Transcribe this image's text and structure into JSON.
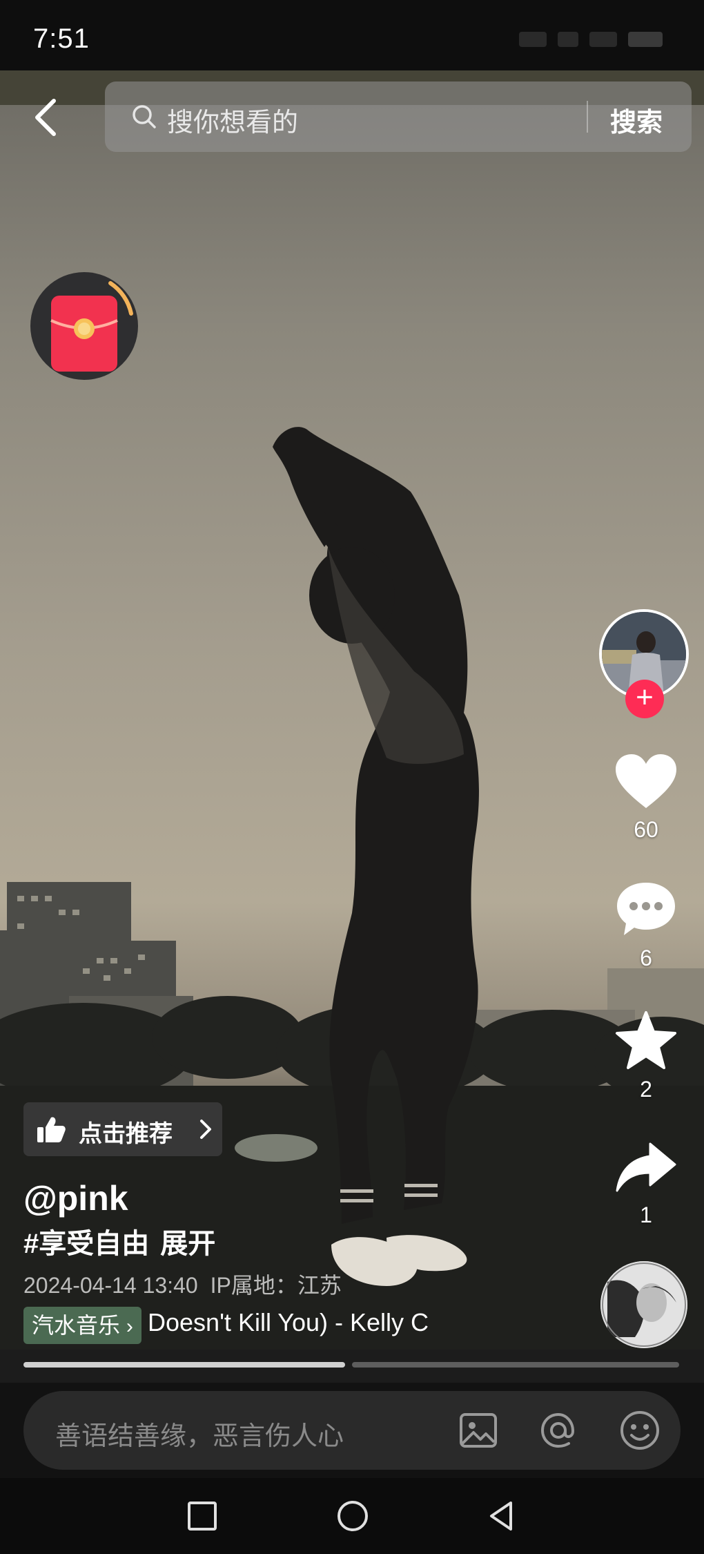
{
  "status_bar": {
    "time": "7:51"
  },
  "search": {
    "placeholder": "搜你想看的",
    "button_label": "搜索"
  },
  "rail": {
    "likes": "60",
    "comments": "6",
    "favorites": "2",
    "shares": "1"
  },
  "post": {
    "recommend_label": "点击推荐",
    "author": "@pink",
    "caption": "#享受自由",
    "expand_label": "展开",
    "datetime": "2024-04-14 13:40",
    "ip_location": "IP属地：江苏",
    "music_chip": "汽水音乐",
    "music_title": "Doesn't Kill You) - Kelly C"
  },
  "progress": {
    "fraction": 0.49
  },
  "comment_bar": {
    "placeholder": "善语结善缘，恶言伤人心"
  },
  "colors": {
    "accent": "#fe2c55",
    "music_chip": "#4b6a52"
  }
}
